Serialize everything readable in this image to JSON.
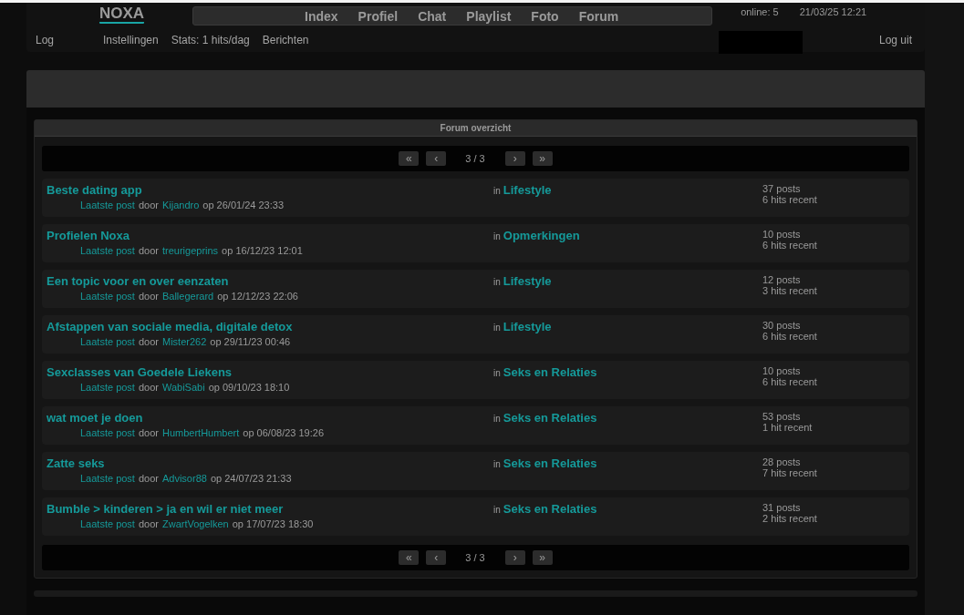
{
  "header": {
    "logo": "NOXA",
    "nav": [
      "Index",
      "Profiel",
      "Chat",
      "Playlist",
      "Foto",
      "Forum"
    ],
    "online": "online: 5",
    "datetime": "21/03/25 12:21",
    "left_links": [
      "Log"
    ],
    "links": [
      "Instellingen",
      "Stats: 1 hits/dag",
      "Berichten"
    ],
    "logout": "Log uit"
  },
  "forum": {
    "title": "Forum overzicht",
    "pagers": [
      {
        "first": "«",
        "prev": "‹",
        "page": "3 / 3",
        "next": "›",
        "last": "»"
      },
      {
        "first": "«",
        "prev": "‹",
        "page": "3 / 3",
        "next": "›",
        "last": "»"
      }
    ],
    "topics": [
      {
        "title": "Beste dating app",
        "last_post": "Laatste post",
        "by": "door",
        "user": "Kijandro",
        "date": "op 26/01/24 23:33",
        "in": "in",
        "category": "Lifestyle",
        "posts": "37 posts",
        "hits": "6 hits recent"
      },
      {
        "title": "Profielen Noxa",
        "last_post": "Laatste post",
        "by": "door",
        "user": "treurigeprins",
        "date": "op 16/12/23 12:01",
        "in": "in",
        "category": "Opmerkingen",
        "posts": "10 posts",
        "hits": "6 hits recent"
      },
      {
        "title": "Een topic voor en over eenzaten",
        "last_post": "Laatste post",
        "by": "door",
        "user": "Ballegerard",
        "date": "op 12/12/23 22:06",
        "in": "in",
        "category": "Lifestyle",
        "posts": "12 posts",
        "hits": "3 hits recent"
      },
      {
        "title": "Afstappen van sociale media, digitale detox",
        "last_post": "Laatste post",
        "by": "door",
        "user": "Mister262",
        "date": "op 29/11/23 00:46",
        "in": "in",
        "category": "Lifestyle",
        "posts": "30 posts",
        "hits": "6 hits recent"
      },
      {
        "title": "Sexclasses van Goedele Liekens",
        "last_post": "Laatste post",
        "by": "door",
        "user": "WabiSabi",
        "date": "op 09/10/23 18:10",
        "in": "in",
        "category": "Seks en Relaties",
        "posts": "10 posts",
        "hits": "6 hits recent"
      },
      {
        "title": "wat moet je doen",
        "last_post": "Laatste post",
        "by": "door",
        "user": "HumbertHumbert",
        "date": "op 06/08/23 19:26",
        "in": "in",
        "category": "Seks en Relaties",
        "posts": "53 posts",
        "hits": "1 hit recent"
      },
      {
        "title": "Zatte seks",
        "last_post": "Laatste post",
        "by": "door",
        "user": "Advisor88",
        "date": "op 24/07/23 21:33",
        "in": "in",
        "category": "Seks en Relaties",
        "posts": "28 posts",
        "hits": "7 hits recent"
      },
      {
        "title": "Bumble > kinderen > ja en wil er niet meer",
        "last_post": "Laatste post",
        "by": "door",
        "user": "ZwartVogelken",
        "date": "op 17/07/23 18:30",
        "in": "in",
        "category": "Seks en Relaties",
        "posts": "31 posts",
        "hits": "2 hits recent"
      }
    ]
  }
}
